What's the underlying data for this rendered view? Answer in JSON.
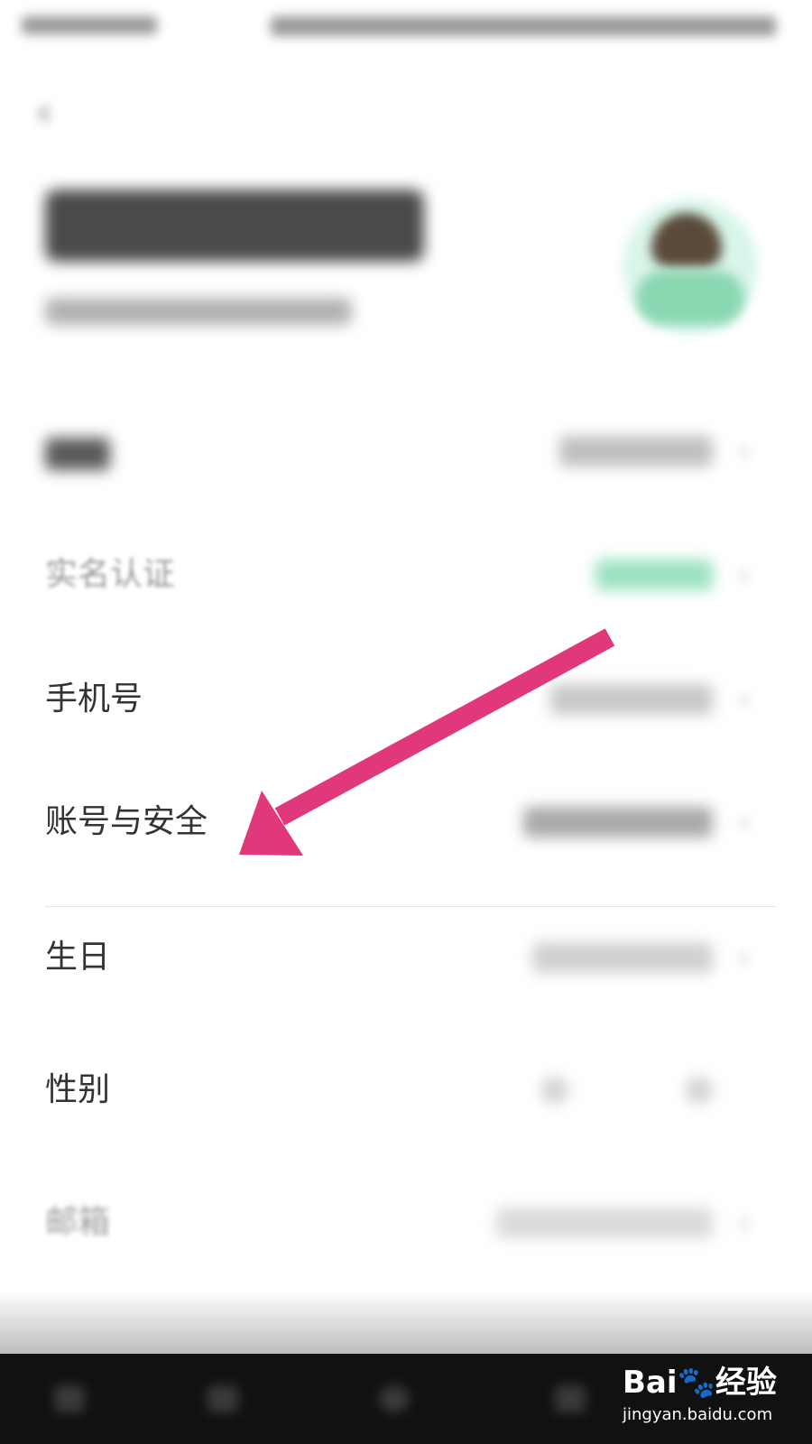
{
  "header": {
    "back_icon": "chevron-left-icon"
  },
  "rows": [
    {
      "label": "实名认证"
    },
    {
      "label": "手机号"
    },
    {
      "label": "账号与安全"
    },
    {
      "label": "生日"
    },
    {
      "label": "性别"
    },
    {
      "label": "邮箱"
    }
  ],
  "colors": {
    "annotation_arrow": "#e0387a",
    "verified_badge": "#9ae2c0",
    "avatar_bg": "#d9f6ea"
  },
  "watermark": {
    "brand": "Bai🐾经验",
    "url": "jingyan.baidu.com"
  }
}
